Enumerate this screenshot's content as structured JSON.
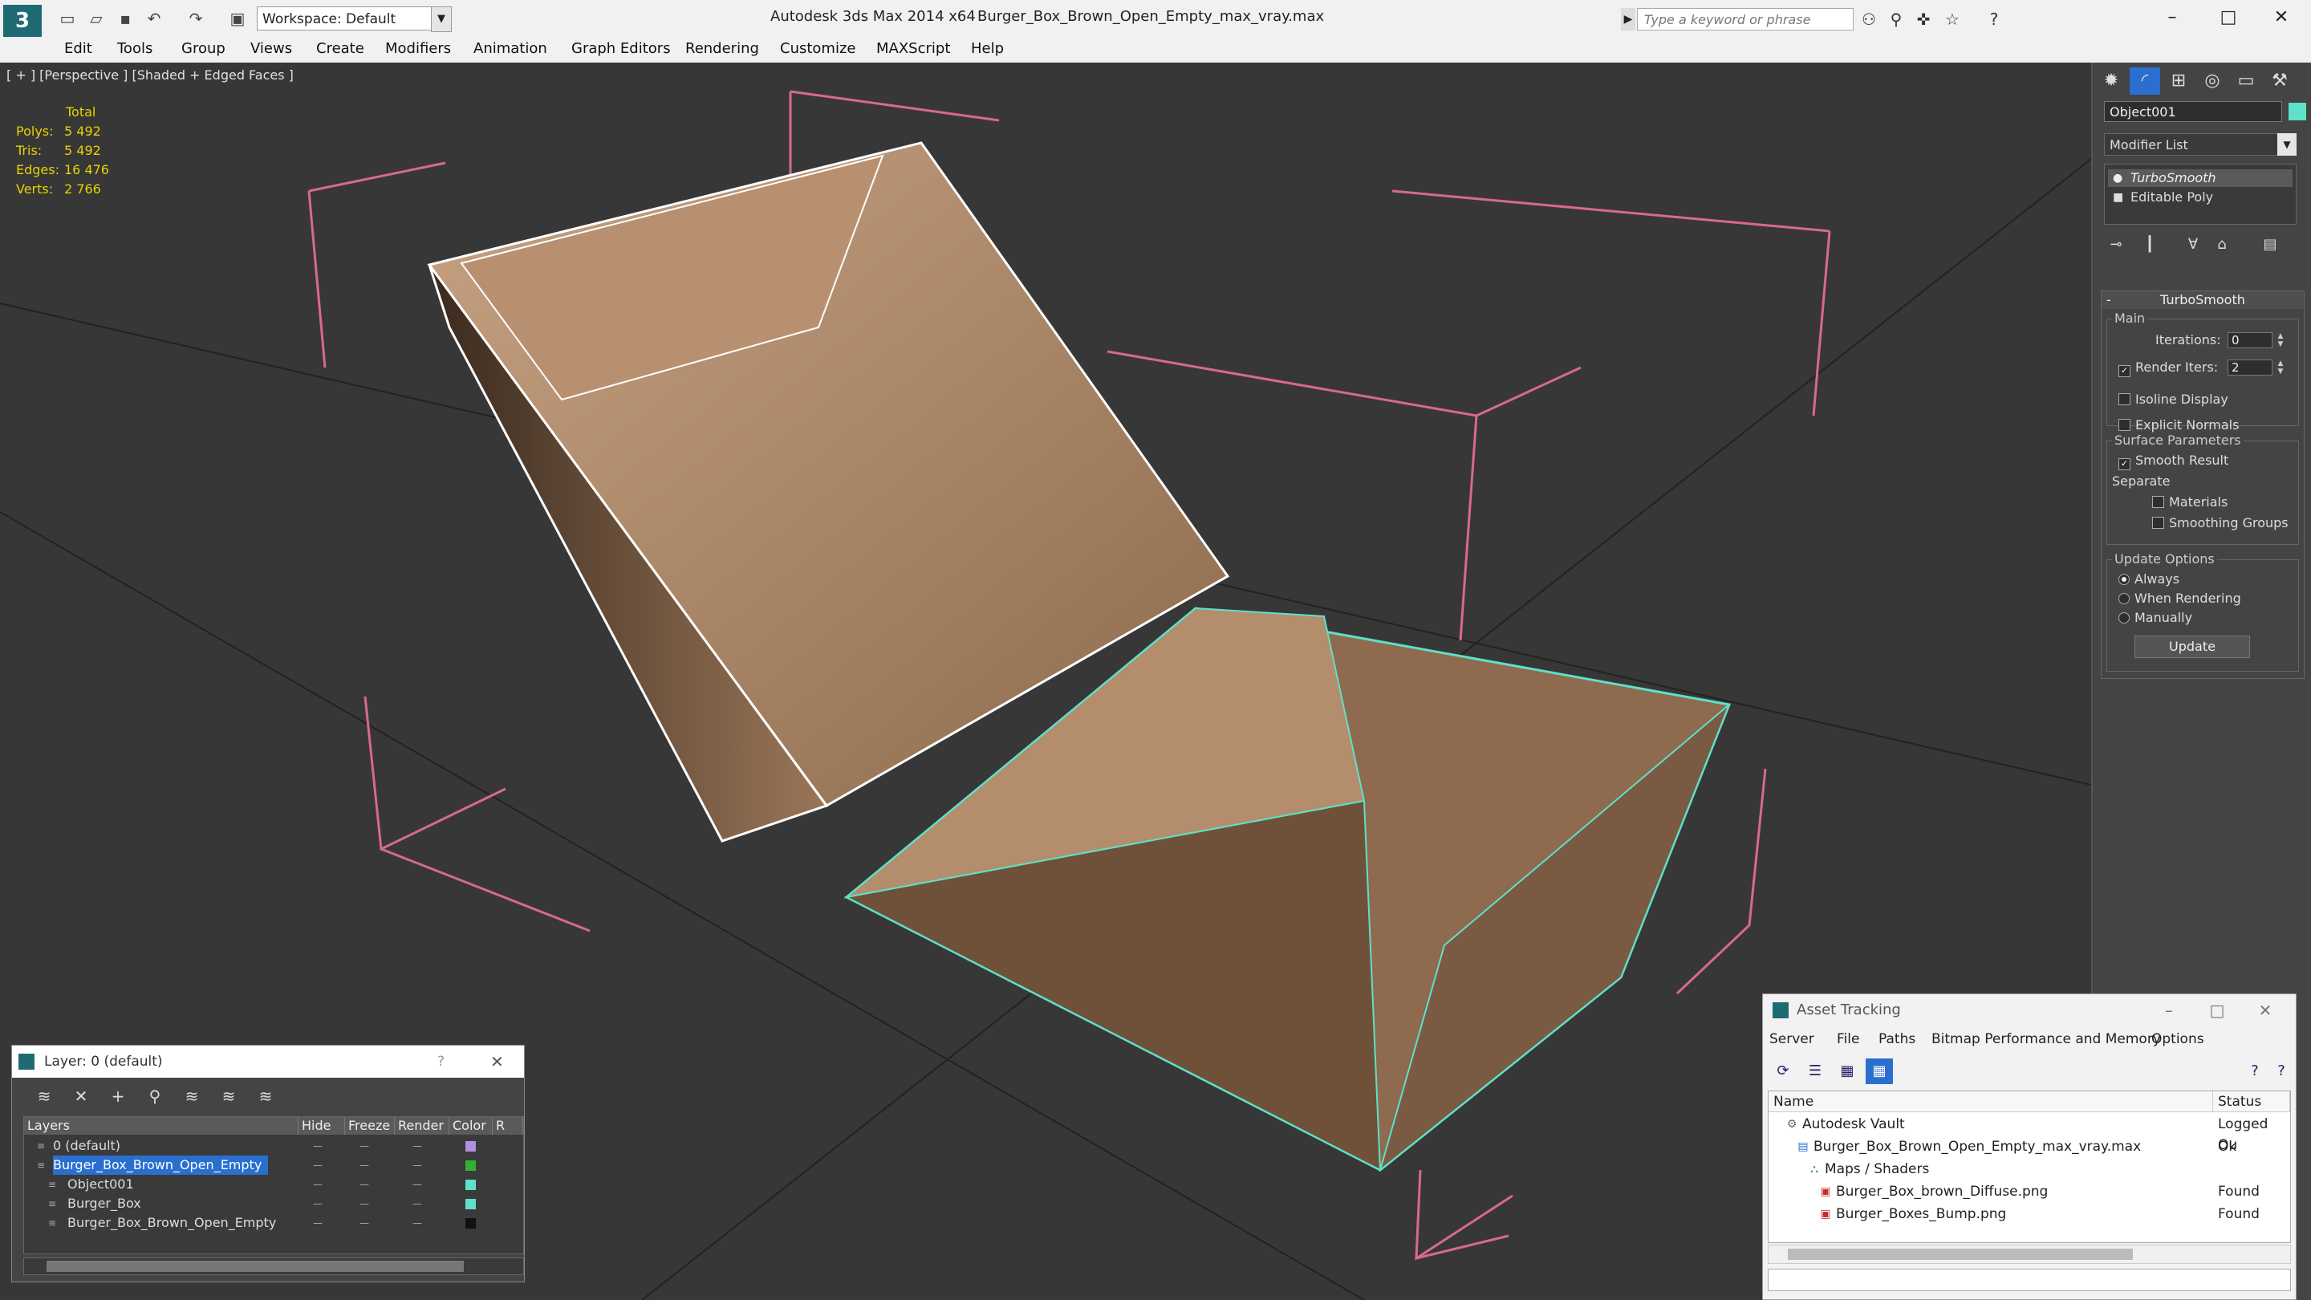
{
  "titlebar": {
    "app_title": "Autodesk 3ds Max 2014 x64",
    "file_title": "Burger_Box_Brown_Open_Empty_max_vray.max",
    "workspace": "Workspace: Default",
    "search_placeholder": "Type a keyword or phrase"
  },
  "menu": [
    "Edit",
    "Tools",
    "Group",
    "Views",
    "Create",
    "Modifiers",
    "Animation",
    "Graph Editors",
    "Rendering",
    "Customize",
    "MAXScript",
    "Help"
  ],
  "viewport": {
    "label": "[ + ] [Perspective ] [Shaded + Edged Faces ]",
    "stats": {
      "header": "Total",
      "rows": [
        {
          "label": "Polys:",
          "value": "5 492"
        },
        {
          "label": "Tris:",
          "value": "5 492"
        },
        {
          "label": "Edges:",
          "value": "16 476"
        },
        {
          "label": "Verts:",
          "value": "2 766"
        }
      ]
    }
  },
  "command_panel": {
    "object_name": "Object001",
    "object_color": "#5fe0c8",
    "modifier_list": "Modifier List",
    "stack": [
      "TurboSmooth",
      "Editable Poly"
    ],
    "turbosmooth": {
      "title": "TurboSmooth",
      "main_label": "Main",
      "iterations_label": "Iterations:",
      "iterations_value": "0",
      "render_iters_label": "Render Iters:",
      "render_iters_value": "2",
      "isoline": "Isoline Display",
      "explicit_normals": "Explicit Normals",
      "surface_params": "Surface Parameters",
      "smooth_result": "Smooth Result",
      "separate": "Separate",
      "materials": "Materials",
      "smoothing_groups": "Smoothing Groups",
      "update_options": "Update Options",
      "always": "Always",
      "when_rendering": "When Rendering",
      "manually": "Manually",
      "update_button": "Update"
    }
  },
  "layer_window": {
    "title": "Layer: 0 (default)",
    "question": "?",
    "columns": [
      "Layers",
      "Hide",
      "Freeze",
      "Render",
      "Color",
      "R"
    ],
    "rows": [
      {
        "name": "0 (default)",
        "indent": 0,
        "color": "#b090e0",
        "selected": false
      },
      {
        "name": "Burger_Box_Brown_Open_Empty",
        "indent": 0,
        "color": "#30b030",
        "selected": true
      },
      {
        "name": "Object001",
        "indent": 1,
        "color": "#5fe0c8",
        "selected": false
      },
      {
        "name": "Burger_Box",
        "indent": 1,
        "color": "#5fe0c8",
        "selected": false
      },
      {
        "name": "Burger_Box_Brown_Open_Empty",
        "indent": 1,
        "color": "#111111",
        "selected": false
      }
    ]
  },
  "asset_window": {
    "title": "Asset Tracking",
    "menus": [
      "Server",
      "File",
      "Paths",
      "Bitmap Performance and Memory",
      "Options"
    ],
    "columns": [
      "Name",
      "Status"
    ],
    "rows": [
      {
        "name": "Autodesk Vault",
        "indent": 0,
        "status": "Logged Ou"
      },
      {
        "name": "Burger_Box_Brown_Open_Empty_max_vray.max",
        "indent": 1,
        "status": "Ok"
      },
      {
        "name": "Maps / Shaders",
        "indent": 2,
        "status": ""
      },
      {
        "name": "Burger_Box_brown_Diffuse.png",
        "indent": 3,
        "status": "Found"
      },
      {
        "name": "Burger_Boxes_Bump.png",
        "indent": 3,
        "status": "Found"
      }
    ]
  }
}
